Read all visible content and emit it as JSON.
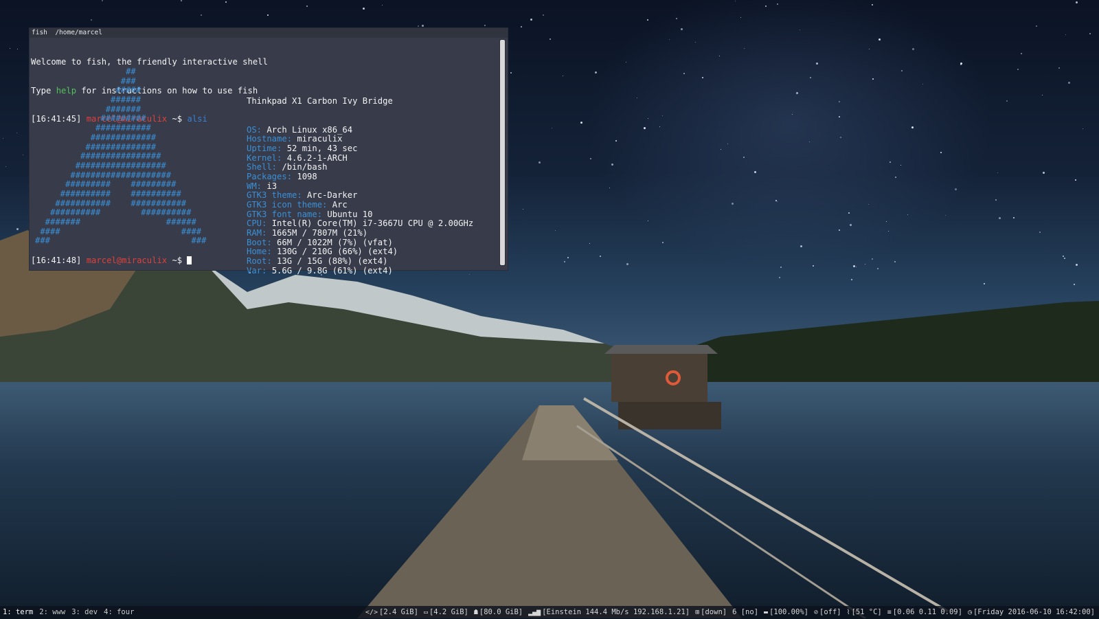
{
  "terminal": {
    "title": "fish  /home/marcel",
    "welcome_line": "Welcome to fish, the friendly interactive shell",
    "type_prefix": "Type ",
    "type_help": "help",
    "type_suffix": " for instructions on how to use fish",
    "prompt1_time": "[16:41:45]",
    "prompt_user": "marcel@miraculix",
    "prompt_path": " ~$ ",
    "command": "alsi",
    "prompt2_time": "[16:41:48]",
    "ascii_art": [
      "                  ##",
      "                 ###",
      "                #####",
      "               ######",
      "              #######",
      "             #########",
      "            ###########",
      "           #############",
      "          ##############",
      "         ################",
      "        ##################",
      "       ####################",
      "      #########    #########",
      "     ##########    ##########",
      "    ###########    ###########",
      "   ##########        ##########",
      "  #######                 ######",
      " ####                        ####",
      "###                            ###"
    ],
    "system_title": "Thinkpad X1 Carbon Ivy Bridge",
    "info": [
      {
        "key": "OS:",
        "value": "Arch Linux x86_64"
      },
      {
        "key": "Hostname:",
        "value": "miraculix"
      },
      {
        "key": "Uptime:",
        "value": "52 min, 43 sec"
      },
      {
        "key": "Kernel:",
        "value": "4.6.2-1-ARCH"
      },
      {
        "key": "Shell:",
        "value": "/bin/bash"
      },
      {
        "key": "Packages:",
        "value": "1098"
      },
      {
        "key": "WM:",
        "value": "i3"
      },
      {
        "key": "GTK3 theme:",
        "value": "Arc-Darker"
      },
      {
        "key": "GTK3 icon theme:",
        "value": "Arc"
      },
      {
        "key": "GTK3 font name:",
        "value": "Ubuntu 10"
      },
      {
        "key": "CPU:",
        "value": "Intel(R) Core(TM) i7-3667U CPU @ 2.00GHz"
      },
      {
        "key": "RAM:",
        "value": "1665M / 7807M (21%)"
      },
      {
        "key": "Boot:",
        "value": "66M / 1022M (7%) (vfat)"
      },
      {
        "key": "Home:",
        "value": "130G / 210G (66%) (ext4)"
      },
      {
        "key": "Root:",
        "value": "13G / 15G (88%) (ext4)"
      },
      {
        "key": "Var:",
        "value": "5.6G / 9.8G (61%) (ext4)"
      }
    ]
  },
  "bar": {
    "workspaces": [
      {
        "label": "1: term",
        "active": true
      },
      {
        "label": "2: www",
        "active": false
      },
      {
        "label": "3: dev",
        "active": false
      },
      {
        "label": "4: four",
        "active": false
      }
    ],
    "status": [
      {
        "icon": "code-icon",
        "glyph": "</>",
        "text": "[2.4 GiB]"
      },
      {
        "icon": "folder-icon",
        "glyph": "▭",
        "text": "[4.2 GiB]"
      },
      {
        "icon": "users-icon",
        "glyph": "☗",
        "text": "[80.0 GiB]"
      },
      {
        "icon": "wifi-signal-icon",
        "glyph": "▂▄▆",
        "text": "[Einstein 144.4 Mb/s 192.168.1.21]"
      },
      {
        "icon": "network-icon",
        "glyph": "⊞",
        "text": "[down]"
      },
      {
        "icon": "",
        "glyph": "",
        "text": "6 [no]"
      },
      {
        "icon": "battery-icon",
        "glyph": "▬",
        "text": "[100.00%]"
      },
      {
        "icon": "no-sign-icon",
        "glyph": "⊘",
        "text": "[off]"
      },
      {
        "icon": "thermometer-icon",
        "glyph": "⌇",
        "text": "[51 °C]"
      },
      {
        "icon": "load-icon",
        "glyph": "≡",
        "text": "[0.06 0.11 0.09]"
      },
      {
        "icon": "clock-icon",
        "glyph": "◷",
        "text": "[Friday 2016-06-10 16:42:00]"
      }
    ]
  }
}
